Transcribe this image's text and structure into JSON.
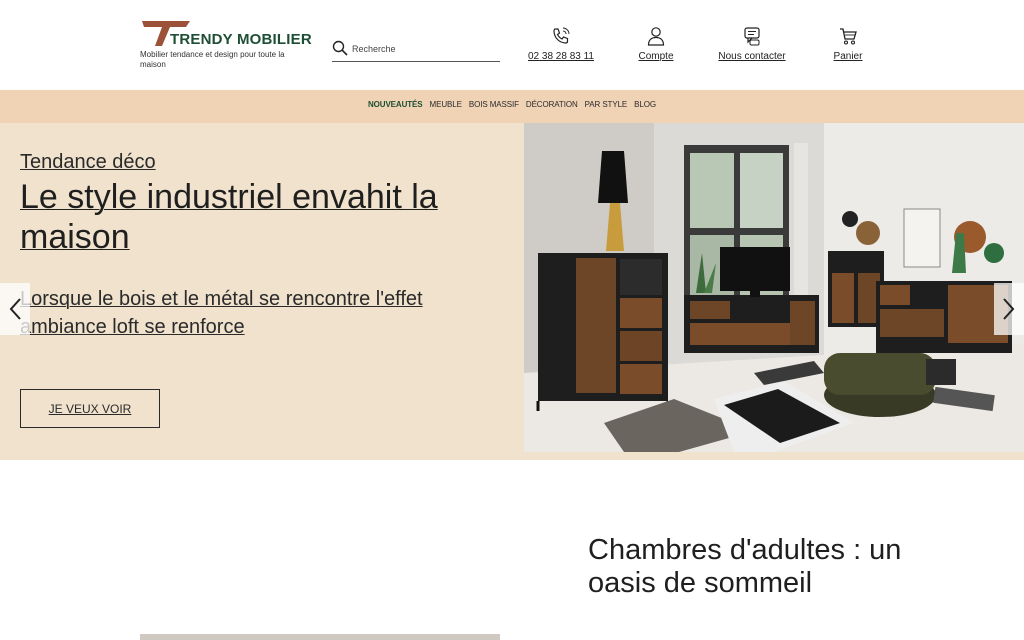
{
  "header": {
    "brand_name": "TRENDY MOBILIER",
    "brand_tagline": "Mobilier tendance et design pour toute la maison",
    "search_placeholder": "Recherche",
    "links": [
      {
        "label": "02 38 28 83 11",
        "icon": "phone-icon"
      },
      {
        "label": "Compte",
        "icon": "user-icon"
      },
      {
        "label": "Nous contacter",
        "icon": "chat-icon"
      },
      {
        "label": "Panier",
        "icon": "cart-icon"
      }
    ]
  },
  "nav": {
    "items": [
      "NOUVEAUTÉS",
      "MEUBLE",
      "BOIS MASSIF",
      "DÉCORATION",
      "PAR STYLE",
      "BLOG"
    ],
    "active": "NOUVEAUTÉS"
  },
  "hero": {
    "eyebrow": "Tendance déco",
    "title": "Le style industriel envahit la maison",
    "subtitle": "Lorsque le bois et le métal se rencontre l'effet ambiance loft se renforce",
    "cta": "JE VEUX VOIR",
    "image": "industrial-living-room-photo"
  },
  "section2": {
    "title": "Chambres d'adultes : un oasis de sommeil"
  },
  "colors": {
    "brand_green": "#1e4f34",
    "brand_brown": "#9c5238",
    "nav_bg": "#f0d2b4",
    "hero_bg": "#f0e2cd"
  }
}
